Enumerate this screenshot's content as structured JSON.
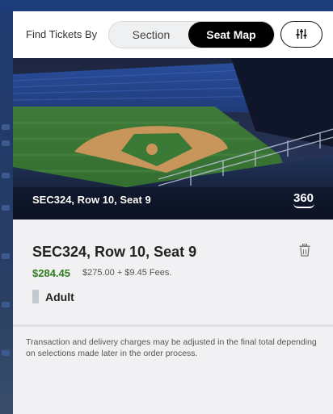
{
  "finder": {
    "label": "Find Tickets By",
    "options": [
      "Section",
      "Seat Map"
    ],
    "selected": "Seat Map",
    "filter_icon": "sliders-icon"
  },
  "seat_view": {
    "caption": "SEC324, Row 10, Seat 9",
    "badge": "360",
    "image": "stadium-view-from-seat"
  },
  "ticket": {
    "title": "SEC324, Row 10, Seat 9",
    "total_price": "$284.45",
    "price_breakdown": "$275.00 + $9.45 Fees.",
    "type": "Adult",
    "delete_icon": "trash-icon"
  },
  "notice": "Transaction and delivery charges may be adjusted in the final total depending on selections made later in the order process.",
  "colors": {
    "selected_toggle": "#000000",
    "price": "#2e7d1f",
    "background": "#f1f1f3"
  }
}
